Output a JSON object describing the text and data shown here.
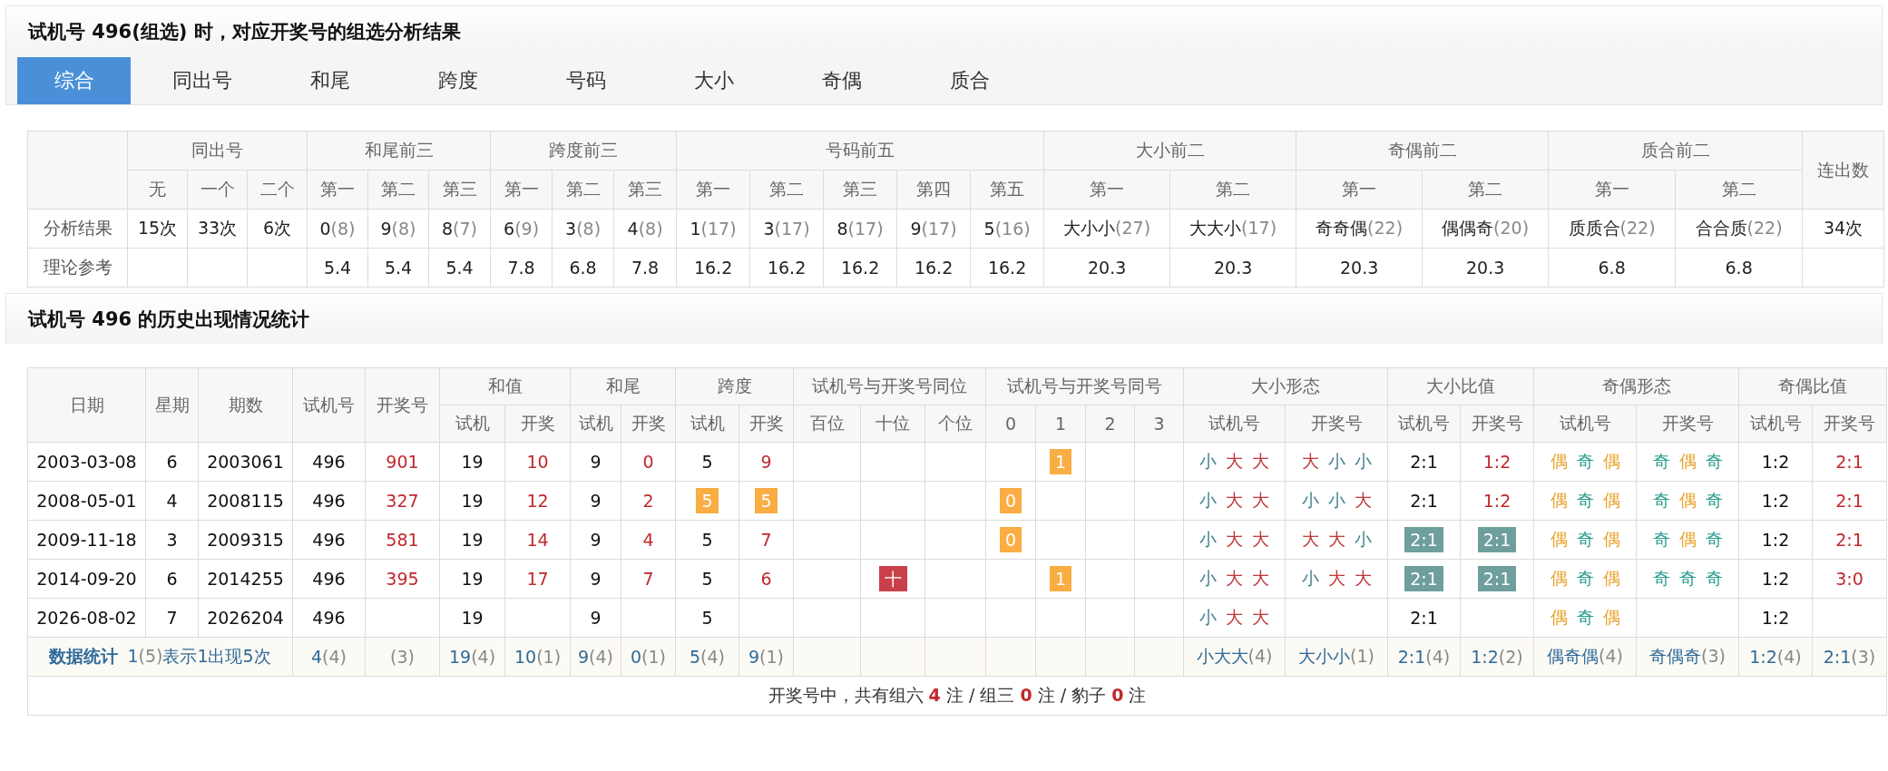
{
  "summary_section": {
    "title": "试机号 496(组选) 时，对应开奖号的组选分析结果",
    "tabs": [
      {
        "label": "综合",
        "selected": true
      },
      {
        "label": "同出号",
        "selected": false
      },
      {
        "label": "和尾",
        "selected": false
      },
      {
        "label": "跨度",
        "selected": false
      },
      {
        "label": "号码",
        "selected": false
      },
      {
        "label": "大小",
        "selected": false
      },
      {
        "label": "奇偶",
        "selected": false
      },
      {
        "label": "质合",
        "selected": false
      }
    ],
    "table": {
      "groups": [
        {
          "label": "同出号",
          "columns": [
            "无",
            "一个",
            "二个"
          ]
        },
        {
          "label": "和尾前三",
          "columns": [
            "第一",
            "第二",
            "第三"
          ]
        },
        {
          "label": "跨度前三",
          "columns": [
            "第一",
            "第二",
            "第三"
          ]
        },
        {
          "label": "号码前五",
          "columns": [
            "第一",
            "第二",
            "第三",
            "第四",
            "第五"
          ]
        },
        {
          "label": "大小前二",
          "columns": [
            "第一",
            "第二"
          ]
        },
        {
          "label": "奇偶前二",
          "columns": [
            "第一",
            "第二"
          ]
        },
        {
          "label": "质合前二",
          "columns": [
            "第一",
            "第二"
          ]
        },
        {
          "label": "连出数"
        }
      ],
      "rows": [
        {
          "label": "分析结果",
          "cells": [
            {
              "value": "15次"
            },
            {
              "value": "33次"
            },
            {
              "value": "6次"
            },
            {
              "value": "0",
              "count": "(8)"
            },
            {
              "value": "9",
              "count": "(8)"
            },
            {
              "value": "8",
              "count": "(7)"
            },
            {
              "value": "6",
              "count": "(9)"
            },
            {
              "value": "3",
              "count": "(8)"
            },
            {
              "value": "4",
              "count": "(8)"
            },
            {
              "value": "1",
              "count": "(17)"
            },
            {
              "value": "3",
              "count": "(17)"
            },
            {
              "value": "8",
              "count": "(17)"
            },
            {
              "value": "9",
              "count": "(17)"
            },
            {
              "value": "5",
              "count": "(16)"
            },
            {
              "value": "大小小",
              "count": "(27)"
            },
            {
              "value": "大大小",
              "count": "(17)"
            },
            {
              "value": "奇奇偶",
              "count": "(22)"
            },
            {
              "value": "偶偶奇",
              "count": "(20)"
            },
            {
              "value": "质质合",
              "count": "(22)"
            },
            {
              "value": "合合质",
              "count": "(22)"
            },
            {
              "value": "34次"
            }
          ]
        },
        {
          "label": "理论参考",
          "cells": [
            null,
            null,
            null,
            {
              "value": "5.4"
            },
            {
              "value": "5.4"
            },
            {
              "value": "5.4"
            },
            {
              "value": "7.8"
            },
            {
              "value": "6.8"
            },
            {
              "value": "7.8"
            },
            {
              "value": "16.2"
            },
            {
              "value": "16.2"
            },
            {
              "value": "16.2"
            },
            {
              "value": "16.2"
            },
            {
              "value": "16.2"
            },
            {
              "value": "20.3"
            },
            {
              "value": "20.3"
            },
            {
              "value": "20.3"
            },
            {
              "value": "20.3"
            },
            {
              "value": "6.8"
            },
            {
              "value": "6.8"
            },
            null
          ]
        }
      ]
    }
  },
  "history_section": {
    "title": "试机号 496 的历史出现情况统计",
    "table": {
      "groups": [
        {
          "label": "日期"
        },
        {
          "label": "星期"
        },
        {
          "label": "期数"
        },
        {
          "label": "试机号"
        },
        {
          "label": "开奖号"
        },
        {
          "label": "和值",
          "columns": [
            "试机",
            "开奖"
          ]
        },
        {
          "label": "和尾",
          "columns": [
            "试机",
            "开奖"
          ]
        },
        {
          "label": "跨度",
          "columns": [
            "试机",
            "开奖"
          ]
        },
        {
          "label": "试机号与开奖号同位",
          "columns": [
            "百位",
            "十位",
            "个位"
          ]
        },
        {
          "label": "试机号与开奖号同号",
          "columns": [
            "0",
            "1",
            "2",
            "3"
          ]
        },
        {
          "label": "大小形态",
          "columns": [
            "试机号",
            "开奖号"
          ]
        },
        {
          "label": "大小比值",
          "columns": [
            "试机号",
            "开奖号"
          ]
        },
        {
          "label": "奇偶形态",
          "columns": [
            "试机号",
            "开奖号"
          ]
        },
        {
          "label": "奇偶比值",
          "columns": [
            "试机号",
            "开奖号"
          ]
        }
      ],
      "rows": [
        {
          "cells": [
            "2003-03-08",
            "6",
            "2003061",
            "496",
            {
              "kind": "draw",
              "text": "901"
            },
            "19",
            {
              "kind": "draw",
              "text": "10"
            },
            "9",
            {
              "kind": "draw",
              "text": "0"
            },
            "5",
            {
              "kind": "draw",
              "text": "9"
            },
            null,
            null,
            null,
            null,
            {
              "kind": "badge",
              "text": "1",
              "color": "#f9ad42"
            },
            null,
            null,
            {
              "kind": "pattern",
              "chars": [
                {
                  "text": "小",
                  "color": "#3f7f8c"
                },
                {
                  "text": "大",
                  "color": "#c0393b"
                },
                {
                  "text": "大",
                  "color": "#c0393b"
                }
              ]
            },
            {
              "kind": "pattern",
              "chars": [
                {
                  "text": "大",
                  "color": "#c0393b"
                },
                {
                  "text": "小",
                  "color": "#3f7f8c"
                },
                {
                  "text": "小",
                  "color": "#3f7f8c"
                }
              ]
            },
            "2:1",
            {
              "kind": "draw",
              "text": "1:2"
            },
            {
              "kind": "pattern",
              "chars": [
                {
                  "text": "偶",
                  "color": "#e8a128"
                },
                {
                  "text": "奇",
                  "color": "#2a9d8f"
                },
                {
                  "text": "偶",
                  "color": "#e8a128"
                }
              ]
            },
            {
              "kind": "pattern",
              "chars": [
                {
                  "text": "奇",
                  "color": "#2a9d8f"
                },
                {
                  "text": "偶",
                  "color": "#e8a128"
                },
                {
                  "text": "奇",
                  "color": "#2a9d8f"
                }
              ]
            },
            "1:2",
            {
              "kind": "draw",
              "text": "2:1"
            }
          ]
        },
        {
          "cells": [
            "2008-05-01",
            "4",
            "2008115",
            "496",
            {
              "kind": "draw",
              "text": "327"
            },
            "19",
            {
              "kind": "draw",
              "text": "12"
            },
            "9",
            {
              "kind": "draw",
              "text": "2"
            },
            {
              "kind": "badge",
              "text": "5",
              "color": "#f9ad42"
            },
            {
              "kind": "badge",
              "text": "5",
              "color": "#f9ad42"
            },
            null,
            null,
            null,
            {
              "kind": "badge",
              "text": "0",
              "color": "#f9ad42"
            },
            null,
            null,
            null,
            {
              "kind": "pattern",
              "chars": [
                {
                  "text": "小",
                  "color": "#3f7f8c"
                },
                {
                  "text": "大",
                  "color": "#c0393b"
                },
                {
                  "text": "大",
                  "color": "#c0393b"
                }
              ]
            },
            {
              "kind": "pattern",
              "chars": [
                {
                  "text": "小",
                  "color": "#3f7f8c"
                },
                {
                  "text": "小",
                  "color": "#3f7f8c"
                },
                {
                  "text": "大",
                  "color": "#c0393b"
                }
              ]
            },
            "2:1",
            {
              "kind": "draw",
              "text": "1:2"
            },
            {
              "kind": "pattern",
              "chars": [
                {
                  "text": "偶",
                  "color": "#e8a128"
                },
                {
                  "text": "奇",
                  "color": "#2a9d8f"
                },
                {
                  "text": "偶",
                  "color": "#e8a128"
                }
              ]
            },
            {
              "kind": "pattern",
              "chars": [
                {
                  "text": "奇",
                  "color": "#2a9d8f"
                },
                {
                  "text": "偶",
                  "color": "#e8a128"
                },
                {
                  "text": "奇",
                  "color": "#2a9d8f"
                }
              ]
            },
            "1:2",
            {
              "kind": "draw",
              "text": "2:1"
            }
          ]
        },
        {
          "cells": [
            "2009-11-18",
            "3",
            "2009315",
            "496",
            {
              "kind": "draw",
              "text": "581"
            },
            "19",
            {
              "kind": "draw",
              "text": "14"
            },
            "9",
            {
              "kind": "draw",
              "text": "4"
            },
            "5",
            {
              "kind": "draw",
              "text": "7"
            },
            null,
            null,
            null,
            {
              "kind": "badge",
              "text": "0",
              "color": "#f9ad42"
            },
            null,
            null,
            null,
            {
              "kind": "pattern",
              "chars": [
                {
                  "text": "小",
                  "color": "#3f7f8c"
                },
                {
                  "text": "大",
                  "color": "#c0393b"
                },
                {
                  "text": "大",
                  "color": "#c0393b"
                }
              ]
            },
            {
              "kind": "pattern",
              "chars": [
                {
                  "text": "大",
                  "color": "#c0393b"
                },
                {
                  "text": "大",
                  "color": "#c0393b"
                },
                {
                  "text": "小",
                  "color": "#3f7f8c"
                }
              ]
            },
            {
              "kind": "badge",
              "text": "2:1",
              "color": "#6f9f9c"
            },
            {
              "kind": "badge",
              "text": "2:1",
              "color": "#6f9f9c"
            },
            {
              "kind": "pattern",
              "chars": [
                {
                  "text": "偶",
                  "color": "#e8a128"
                },
                {
                  "text": "奇",
                  "color": "#2a9d8f"
                },
                {
                  "text": "偶",
                  "color": "#e8a128"
                }
              ]
            },
            {
              "kind": "pattern",
              "chars": [
                {
                  "text": "奇",
                  "color": "#2a9d8f"
                },
                {
                  "text": "偶",
                  "color": "#e8a128"
                },
                {
                  "text": "奇",
                  "color": "#2a9d8f"
                }
              ]
            },
            "1:2",
            {
              "kind": "draw",
              "text": "2:1"
            }
          ]
        },
        {
          "cells": [
            "2014-09-20",
            "6",
            "2014255",
            "496",
            {
              "kind": "draw",
              "text": "395"
            },
            "19",
            {
              "kind": "draw",
              "text": "17"
            },
            "9",
            {
              "kind": "draw",
              "text": "7"
            },
            "5",
            {
              "kind": "draw",
              "text": "6"
            },
            null,
            {
              "kind": "badge",
              "text": "十",
              "color": "#c9404a"
            },
            null,
            null,
            {
              "kind": "badge",
              "text": "1",
              "color": "#f9ad42"
            },
            null,
            null,
            {
              "kind": "pattern",
              "chars": [
                {
                  "text": "小",
                  "color": "#3f7f8c"
                },
                {
                  "text": "大",
                  "color": "#c0393b"
                },
                {
                  "text": "大",
                  "color": "#c0393b"
                }
              ]
            },
            {
              "kind": "pattern",
              "chars": [
                {
                  "text": "小",
                  "color": "#3f7f8c"
                },
                {
                  "text": "大",
                  "color": "#c0393b"
                },
                {
                  "text": "大",
                  "color": "#c0393b"
                }
              ]
            },
            {
              "kind": "badge",
              "text": "2:1",
              "color": "#6f9f9c"
            },
            {
              "kind": "badge",
              "text": "2:1",
              "color": "#6f9f9c"
            },
            {
              "kind": "pattern",
              "chars": [
                {
                  "text": "偶",
                  "color": "#e8a128"
                },
                {
                  "text": "奇",
                  "color": "#2a9d8f"
                },
                {
                  "text": "偶",
                  "color": "#e8a128"
                }
              ]
            },
            {
              "kind": "pattern",
              "chars": [
                {
                  "text": "奇",
                  "color": "#2a9d8f"
                },
                {
                  "text": "奇",
                  "color": "#2a9d8f"
                },
                {
                  "text": "奇",
                  "color": "#2a9d8f"
                }
              ]
            },
            "1:2",
            {
              "kind": "draw",
              "text": "3:0"
            }
          ]
        },
        {
          "cells": [
            "2026-08-02",
            "7",
            "2026204",
            "496",
            null,
            "19",
            null,
            "9",
            null,
            "5",
            null,
            null,
            null,
            null,
            null,
            null,
            null,
            null,
            {
              "kind": "pattern",
              "chars": [
                {
                  "text": "小",
                  "color": "#3f7f8c"
                },
                {
                  "text": "大",
                  "color": "#c0393b"
                },
                {
                  "text": "大",
                  "color": "#c0393b"
                }
              ]
            },
            null,
            "2:1",
            null,
            {
              "kind": "pattern",
              "chars": [
                {
                  "text": "偶",
                  "color": "#e8a128"
                },
                {
                  "text": "奇",
                  "color": "#2a9d8f"
                },
                {
                  "text": "偶",
                  "color": "#e8a128"
                }
              ]
            },
            null,
            "1:2",
            null
          ]
        }
      ],
      "stats": {
        "summary": {
          "label": "数据统计",
          "value": "1",
          "count": "(5)",
          "note": "表示1出现5次"
        },
        "cells": [
          {
            "value": "4",
            "count": "(4)"
          },
          {
            "count": "(3)"
          },
          {
            "value": "19",
            "count": "(4)"
          },
          {
            "value": "10",
            "count": "(1)"
          },
          {
            "value": "9",
            "count": "(4)"
          },
          {
            "value": "0",
            "count": "(1)"
          },
          {
            "value": "5",
            "count": "(4)"
          },
          {
            "value": "9",
            "count": "(1)"
          },
          null,
          null,
          null,
          null,
          null,
          null,
          null,
          {
            "value": "小大大",
            "count": "(4)"
          },
          {
            "value": "大小小",
            "count": "(1)"
          },
          {
            "value": "2:1",
            "count": "(4)"
          },
          {
            "value": "1:2",
            "count": "(2)"
          },
          {
            "value": "偶奇偶",
            "count": "(4)"
          },
          {
            "value": "奇偶奇",
            "count": "(3)"
          },
          {
            "value": "1:2",
            "count": "(4)"
          },
          {
            "value": "2:1",
            "count": "(3)"
          }
        ]
      },
      "footer": "开奖号中，共有组六 **4** 注 / 组三 **0** 注 / 豹子 **0** 注"
    }
  }
}
